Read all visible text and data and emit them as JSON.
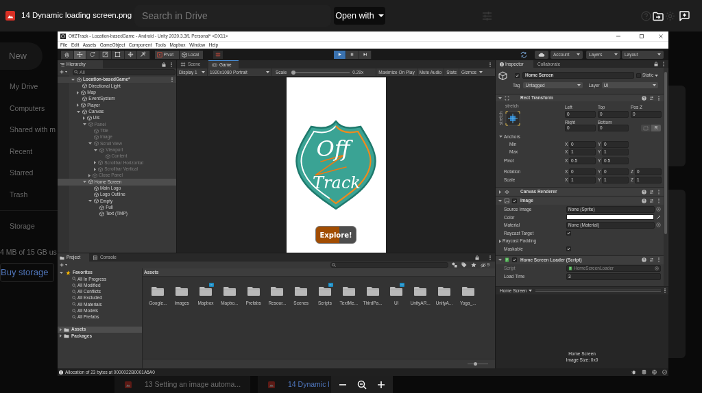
{
  "drive_bar": {
    "file_name": "14 Dynamic loading screen.png",
    "search": {
      "placeholder": "Search in Drive"
    },
    "open_with": "Open with"
  },
  "drive_sidebar": {
    "new_button": "New",
    "items": [
      "My Drive",
      "Computers",
      "Shared with m",
      "Recent",
      "Starred",
      "Trash"
    ],
    "storage": "Storage",
    "usage": "4 MB of 15 GB us",
    "buy_storage": "Buy storage"
  },
  "unity": {
    "title": "OffZTrack - Location-basedGame - Android - Unity 2020.3.3f1 Personal* <DX11>",
    "menu": [
      "File",
      "Edit",
      "Assets",
      "GameObject",
      "Component",
      "Tools",
      "Mapbox",
      "Window",
      "Help"
    ],
    "toolbar": {
      "tools": [
        {
          "kind": "hand",
          "selected": false
        },
        {
          "kind": "move",
          "selected": true
        },
        {
          "kind": "rotate",
          "selected": false
        },
        {
          "kind": "scale",
          "selected": false
        },
        {
          "kind": "rect",
          "selected": false
        },
        {
          "kind": "transform",
          "selected": false
        },
        {
          "kind": "custom",
          "selected": false
        }
      ],
      "pivot": "Pivot",
      "local": "Local",
      "playback": [
        {
          "kind": "play",
          "selected": true
        },
        {
          "kind": "pause",
          "selected": false
        },
        {
          "kind": "step",
          "selected": false
        }
      ],
      "account": "Account",
      "layers": "Layers",
      "layout": "Layout"
    },
    "hierarchy": {
      "tab": "Hierarchy",
      "search": {
        "placeholder": "All"
      },
      "tree": [
        {
          "label": "Location-basedGame*",
          "kind": "scene",
          "expanded": true,
          "active": true,
          "selected": false,
          "children": [
            {
              "label": "Directional Light",
              "kind": "object",
              "active": true,
              "selected": false
            },
            {
              "label": "Map",
              "kind": "object",
              "expanded": false,
              "active": true,
              "selected": false
            },
            {
              "label": "EventSystem",
              "kind": "object",
              "active": true,
              "selected": false
            },
            {
              "label": "Player",
              "kind": "object",
              "expanded": false,
              "active": true,
              "selected": false
            },
            {
              "label": "Canvas",
              "kind": "object",
              "expanded": true,
              "active": true,
              "selected": false,
              "children": [
                {
                  "label": "UIs",
                  "kind": "object",
                  "expanded": false,
                  "active": true,
                  "selected": false
                },
                {
                  "label": "Panel",
                  "kind": "object",
                  "expanded": true,
                  "active": false,
                  "selected": false,
                  "children": [
                    {
                      "label": "Title",
                      "kind": "object",
                      "active": false,
                      "selected": false
                    },
                    {
                      "label": "Image",
                      "kind": "object",
                      "active": false,
                      "selected": false
                    },
                    {
                      "label": "Scroll View",
                      "kind": "object",
                      "expanded": true,
                      "active": false,
                      "selected": false,
                      "children": [
                        {
                          "label": "Viewport",
                          "kind": "object",
                          "expanded": true,
                          "active": false,
                          "selected": false,
                          "children": [
                            {
                              "label": "Content",
                              "kind": "object",
                              "active": false,
                              "selected": false
                            }
                          ]
                        },
                        {
                          "label": "Scrollbar Horizontal",
                          "kind": "object",
                          "expanded": false,
                          "active": false,
                          "selected": false
                        },
                        {
                          "label": "Scrollbar Vertical",
                          "kind": "object",
                          "expanded": false,
                          "active": false,
                          "selected": false
                        }
                      ]
                    },
                    {
                      "label": "Close Panel",
                      "kind": "object",
                      "expanded": false,
                      "active": false,
                      "selected": false
                    }
                  ]
                },
                {
                  "label": "Home Screen",
                  "kind": "object",
                  "expanded": true,
                  "active": true,
                  "selected": true,
                  "children": [
                    {
                      "label": "Main Logo",
                      "kind": "object",
                      "active": true,
                      "selected": false
                    },
                    {
                      "label": "Logo Outline",
                      "kind": "object",
                      "active": true,
                      "selected": false
                    },
                    {
                      "label": "Empty",
                      "kind": "object",
                      "expanded": true,
                      "active": true,
                      "selected": false,
                      "children": [
                        {
                          "label": "Full",
                          "kind": "object",
                          "active": true,
                          "selected": false
                        },
                        {
                          "label": "Text (TMP)",
                          "kind": "object",
                          "active": true,
                          "selected": false
                        }
                      ]
                    }
                  ]
                }
              ]
            }
          ]
        }
      ]
    },
    "game_view": {
      "tabs": [
        {
          "label": "Scene",
          "kind": "scene",
          "selected": false
        },
        {
          "label": "Game",
          "kind": "game",
          "selected": true
        }
      ],
      "display": "Display 1",
      "resolution": "1920x1080 Portrait",
      "scale_label": "Scale",
      "scale": {
        "level": 0
      },
      "scale_reading": "0.29x",
      "options": [
        {
          "label": "Maximize On Play",
          "kind": "toggle"
        },
        {
          "label": "Mute Audio",
          "kind": "toggle"
        },
        {
          "label": "Stats",
          "kind": "toggle"
        },
        {
          "label": "Gizmos",
          "kind": "dropdown"
        }
      ],
      "frame": {
        "logo_top": "Off",
        "logo_bottom": "Track",
        "button": "Explore!"
      }
    },
    "inspector": {
      "tabs": [
        {
          "label": "Inspector",
          "kind": "inspector",
          "selected": true
        },
        {
          "label": "Collaborate",
          "kind": "collaborate",
          "selected": false
        }
      ],
      "object": {
        "active": true,
        "name": "Home Screen",
        "static": false,
        "static_label": "Static",
        "tag_label": "Tag",
        "tag": "Untagged",
        "layer_label": "Layer",
        "layer": "UI"
      },
      "rect_transform": {
        "title": "Rect Transform",
        "expanded": true,
        "preset_top": "stretch",
        "preset_side": "stretch",
        "offsets": [
          {
            "label": "Left",
            "value": "0"
          },
          {
            "label": "Top",
            "value": "0"
          },
          {
            "label": "Pos Z",
            "value": "0"
          },
          {
            "label": "Right",
            "value": "0"
          },
          {
            "label": "Bottom",
            "value": "0"
          }
        ],
        "raw_button": "R",
        "anchors": {
          "label": "Anchors",
          "expanded": true,
          "rows": [
            {
              "label": "Min",
              "values": [
                {
                  "axis": "X",
                  "value": "0"
                },
                {
                  "axis": "Y",
                  "value": "0"
                }
              ]
            },
            {
              "label": "Max",
              "values": [
                {
                  "axis": "X",
                  "value": "1"
                },
                {
                  "axis": "Y",
                  "value": "1"
                }
              ]
            }
          ]
        },
        "pivot": {
          "label": "Pivot",
          "values": [
            {
              "axis": "X",
              "value": "0.5"
            },
            {
              "axis": "Y",
              "value": "0.5"
            }
          ]
        },
        "transforms": [
          {
            "label": "Rotation",
            "values": [
              {
                "axis": "X",
                "value": "0"
              },
              {
                "axis": "Y",
                "value": "0"
              },
              {
                "axis": "Z",
                "value": "0"
              }
            ]
          },
          {
            "label": "Scale",
            "values": [
              {
                "axis": "X",
                "value": "1"
              },
              {
                "axis": "Y",
                "value": "1"
              },
              {
                "axis": "Z",
                "value": "1"
              }
            ]
          }
        ]
      },
      "components": [
        {
          "kind": "canvas_renderer",
          "title": "Canvas Renderer",
          "expanded": false
        },
        {
          "kind": "image",
          "title": "Image",
          "expanded": true,
          "enabled": true,
          "properties": [
            {
              "kind": "object",
              "label": "Source Image",
              "value": "None (Sprite)"
            },
            {
              "kind": "color",
              "label": "Color",
              "color": "#ffffff"
            },
            {
              "kind": "object",
              "label": "Material",
              "value": "None (Material)"
            },
            {
              "kind": "toggle",
              "label": "Raycast Target",
              "checked": true
            },
            {
              "kind": "foldout",
              "label": "Raycast Padding",
              "expanded": false
            },
            {
              "kind": "toggle",
              "label": "Maskable",
              "checked": true
            }
          ]
        },
        {
          "kind": "script",
          "title": "Home Screen Loader (Script)",
          "expanded": true,
          "enabled": true,
          "properties": [
            {
              "kind": "script",
              "label": "Script",
              "value": "HomeScreenLoader"
            },
            {
              "kind": "text",
              "label": "Load Time",
              "value": "3"
            }
          ]
        }
      ],
      "footer": "Home Screen",
      "preview": {
        "title": "Home Screen",
        "info": "Image Size: 0x0"
      }
    },
    "project": {
      "tabs": [
        {
          "label": "Project",
          "kind": "project",
          "selected": true
        },
        {
          "label": "Console",
          "kind": "console",
          "selected": false
        }
      ],
      "hidden_count": "9",
      "favorites": {
        "label": "Favorites",
        "expanded": true,
        "items": [
          "All In Progress",
          "All Modified",
          "All Conflicts",
          "All Excluded",
          "All Materials",
          "All Models",
          "All Prefabs"
        ]
      },
      "roots": [
        {
          "label": "Assets",
          "expanded": false,
          "selected": true
        },
        {
          "label": "Packages",
          "expanded": false,
          "selected": false
        }
      ],
      "path": "Assets",
      "folders": [
        {
          "label": "Google...",
          "badge": false
        },
        {
          "label": "Images",
          "badge": false
        },
        {
          "label": "Mapbox",
          "badge": true
        },
        {
          "label": "Mapbo...",
          "badge": false
        },
        {
          "label": "Prefabs",
          "badge": false
        },
        {
          "label": "Resour...",
          "badge": false
        },
        {
          "label": "Scenes",
          "badge": false
        },
        {
          "label": "Scripts",
          "badge": true
        },
        {
          "label": "TextMe...",
          "badge": false
        },
        {
          "label": "ThirdPa...",
          "badge": false
        },
        {
          "label": "UI",
          "badge": true
        },
        {
          "label": "UnityAR...",
          "badge": false
        },
        {
          "label": "UnityA...",
          "badge": false
        },
        {
          "label": "Yoga_...",
          "badge": false
        }
      ],
      "icon_size": {
        "level": 0.35
      }
    },
    "status_bar": {
      "message": "Allocation of 23 bytes at 0000022B0001A5A0"
    }
  },
  "drive_strip": {
    "files": [
      {
        "label": "13 Setting an image automa...",
        "selected": false
      },
      {
        "label": "14 Dynamic l",
        "selected": true
      }
    ]
  }
}
